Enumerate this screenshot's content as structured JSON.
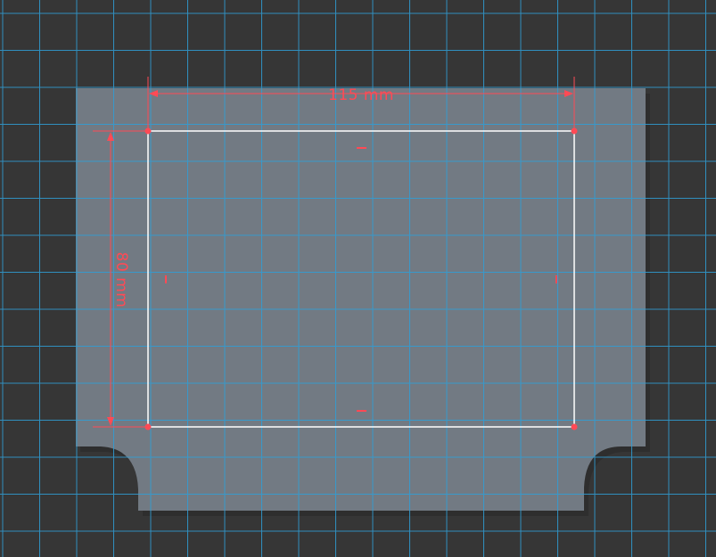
{
  "colors": {
    "background": "#363636",
    "grid_line": "#2f9fd8",
    "plate_fill": "#727a83",
    "plate_shadow": "#2e2e2e",
    "rectangle_stroke": "#ffffff",
    "dimension": "#ff4a55"
  },
  "dimensions": {
    "width_label": "115 mm",
    "height_label": "80 mm"
  },
  "sketch": {
    "shape": "rectangle",
    "width_mm": 115,
    "height_mm": 80,
    "corner_handles": 4,
    "edge_constraint_marks": 4
  }
}
